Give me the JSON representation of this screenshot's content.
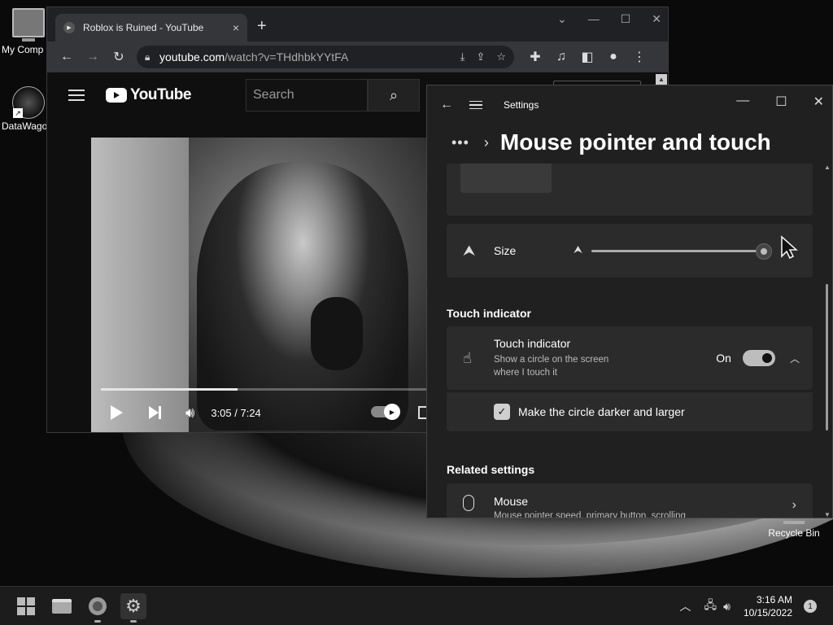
{
  "desktop": {
    "icons": [
      {
        "label": "My Comp",
        "icon": "monitor-icon"
      },
      {
        "label": "DataWago",
        "icon": "datawagon-icon"
      }
    ],
    "recycle_bin": "Recycle Bin"
  },
  "chrome": {
    "tab_title": "Roblox is Ruined - YouTube",
    "tab_close": "×",
    "new_tab": "+",
    "url_host": "youtube.com",
    "url_path": "/watch?v=THdhbkYYtFA",
    "icons": [
      "back-icon",
      "forward-icon",
      "reload-icon",
      "lock-icon",
      "install-icon",
      "share-icon",
      "star-icon",
      "extensions-icon",
      "media-icon",
      "sidepanel-icon",
      "profile-icon",
      "menu-icon"
    ]
  },
  "youtube": {
    "logo_text": "YouTube",
    "search_placeholder": "Search",
    "video_time": "3:05 / 7:24",
    "progress": 0.42
  },
  "settings": {
    "app_title": "Settings",
    "breadcrumb_dots": "•••",
    "page_title": "Mouse pointer and touch",
    "size_label": "Size",
    "size_slider_value": 1.0,
    "touch_section": "Touch indicator",
    "touch_title": "Touch indicator",
    "touch_desc": "Show a circle on the screen where I touch it",
    "toggle_state": "On",
    "checkbox_label": "Make the circle darker and larger",
    "related_section": "Related settings",
    "mouse_title": "Mouse",
    "mouse_desc": "Mouse pointer speed, primary button, scrolling"
  },
  "taskbar": {
    "time": "3:16 AM",
    "date": "10/15/2022",
    "notifications": "1"
  }
}
